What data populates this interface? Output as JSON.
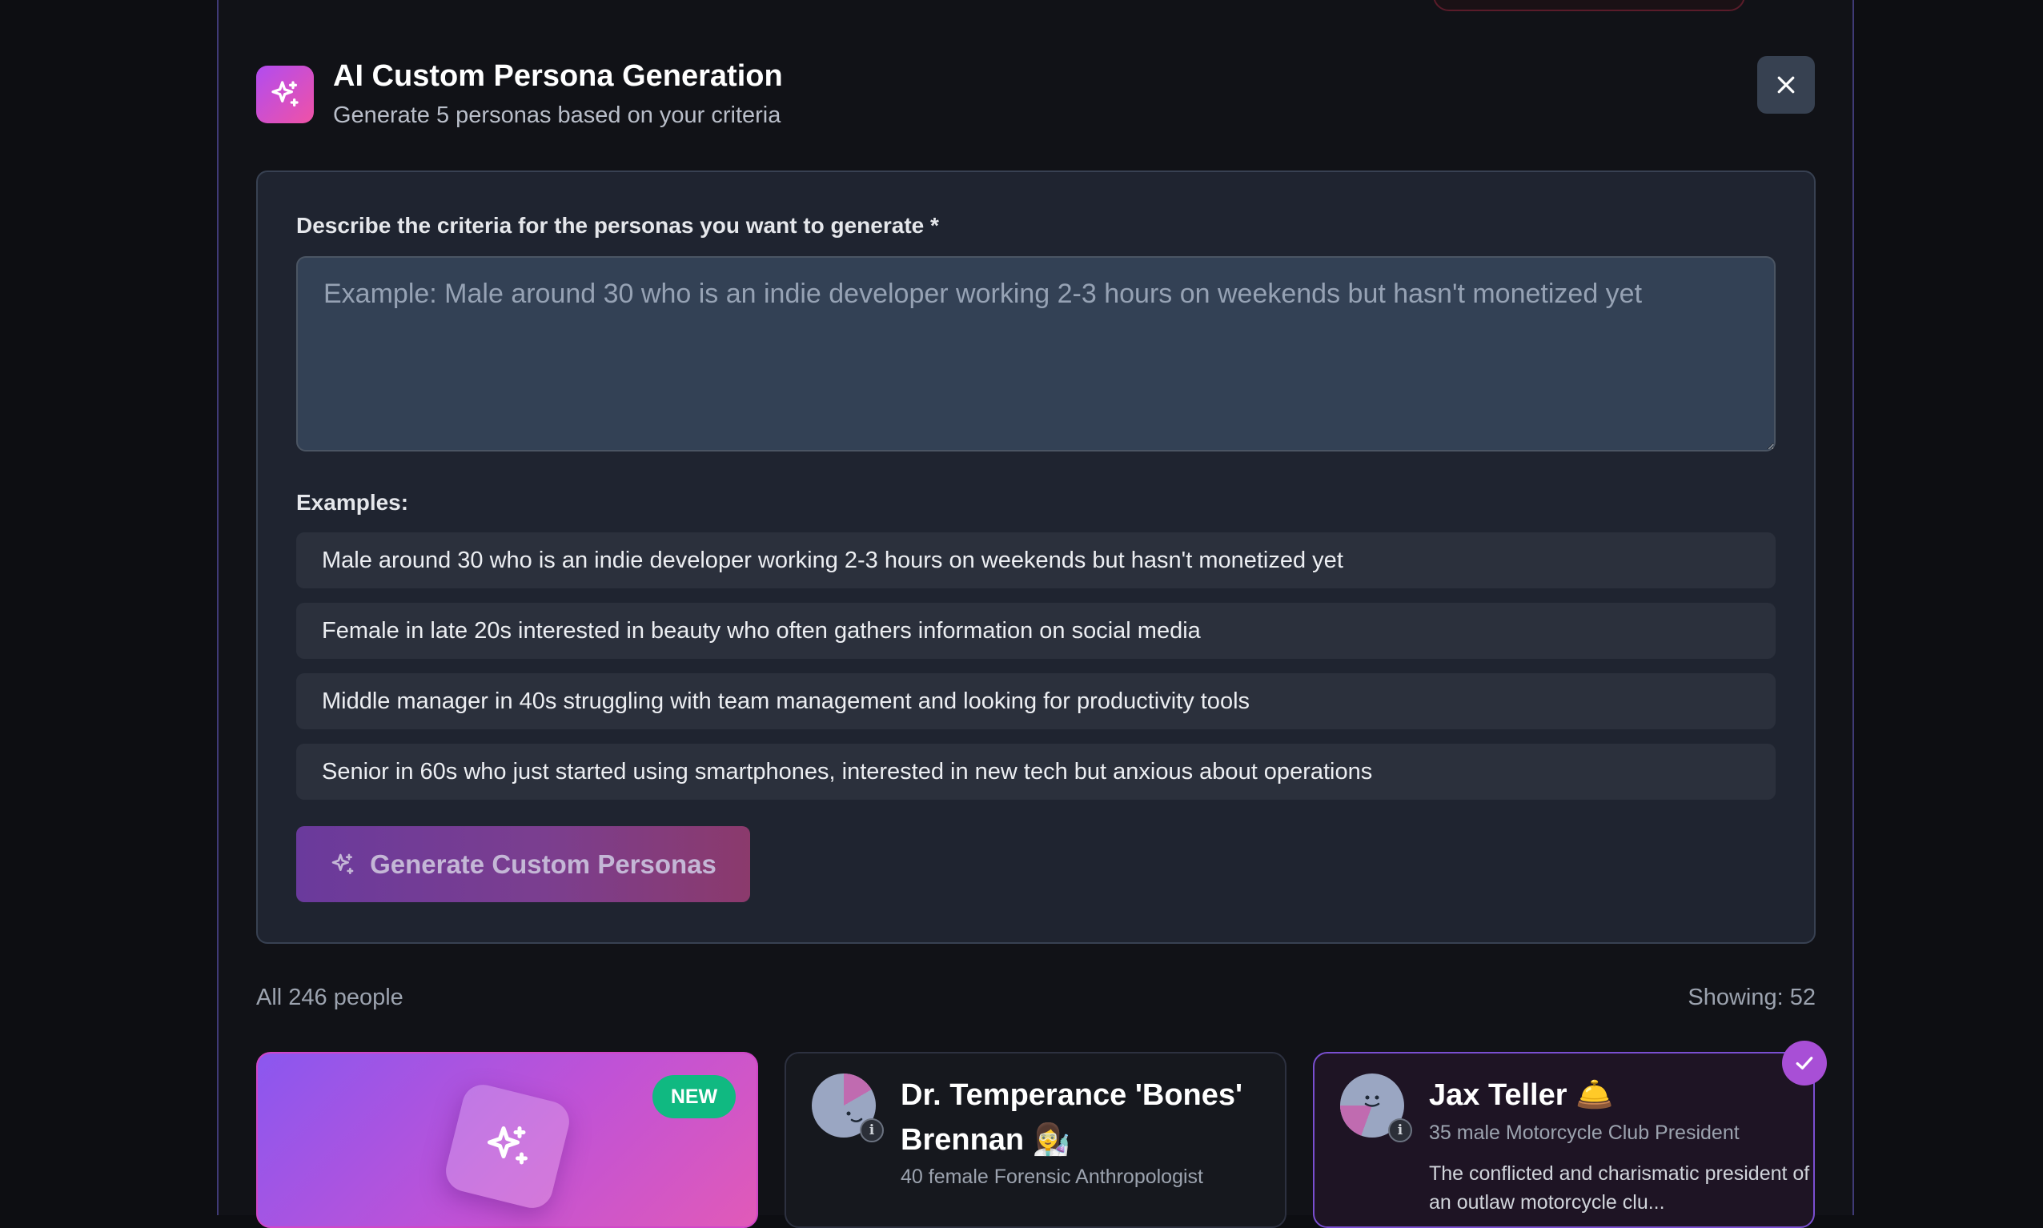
{
  "modal": {
    "title": "AI Custom Persona Generation",
    "subtitle": "Generate 5 personas based on your criteria"
  },
  "form": {
    "label": "Describe the criteria for the personas you want to generate *",
    "placeholder": "Example: Male around 30 who is an indie developer working 2-3 hours on weekends but hasn't monetized yet",
    "examples_label": "Examples:",
    "examples": [
      "Male around 30 who is an indie developer working 2-3 hours on weekends but hasn't monetized yet",
      "Female in late 20s interested in beauty who often gathers information on social media",
      "Middle manager in 40s struggling with team management and looking for productivity tools",
      "Senior in 60s who just started using smartphones, interested in new tech but anxious about operations"
    ],
    "generate_label": "Generate Custom Personas"
  },
  "list": {
    "all_count": "All 246 people",
    "showing": "Showing: 52"
  },
  "cards": {
    "new_badge": "NEW",
    "persona1": {
      "name": "Dr. Temperance 'Bones' Brennan 👩‍🔬",
      "meta": "40 female Forensic Anthropologist"
    },
    "persona2": {
      "name": "Jax Teller 🛎️",
      "meta": "35 male Motorcycle Club President",
      "desc": "The conflicted and charismatic president of an outlaw motorcycle clu..."
    }
  },
  "colors": {
    "accent_gradient_start": "#b14cf0",
    "accent_gradient_end": "#f052a6",
    "badge_green": "#10b981",
    "selected_check": "#a84fd6"
  },
  "icons": {
    "header": "sparkles-icon",
    "close": "close-icon",
    "generate": "sparkles-icon",
    "selected": "check-icon",
    "info": "info-icon"
  }
}
